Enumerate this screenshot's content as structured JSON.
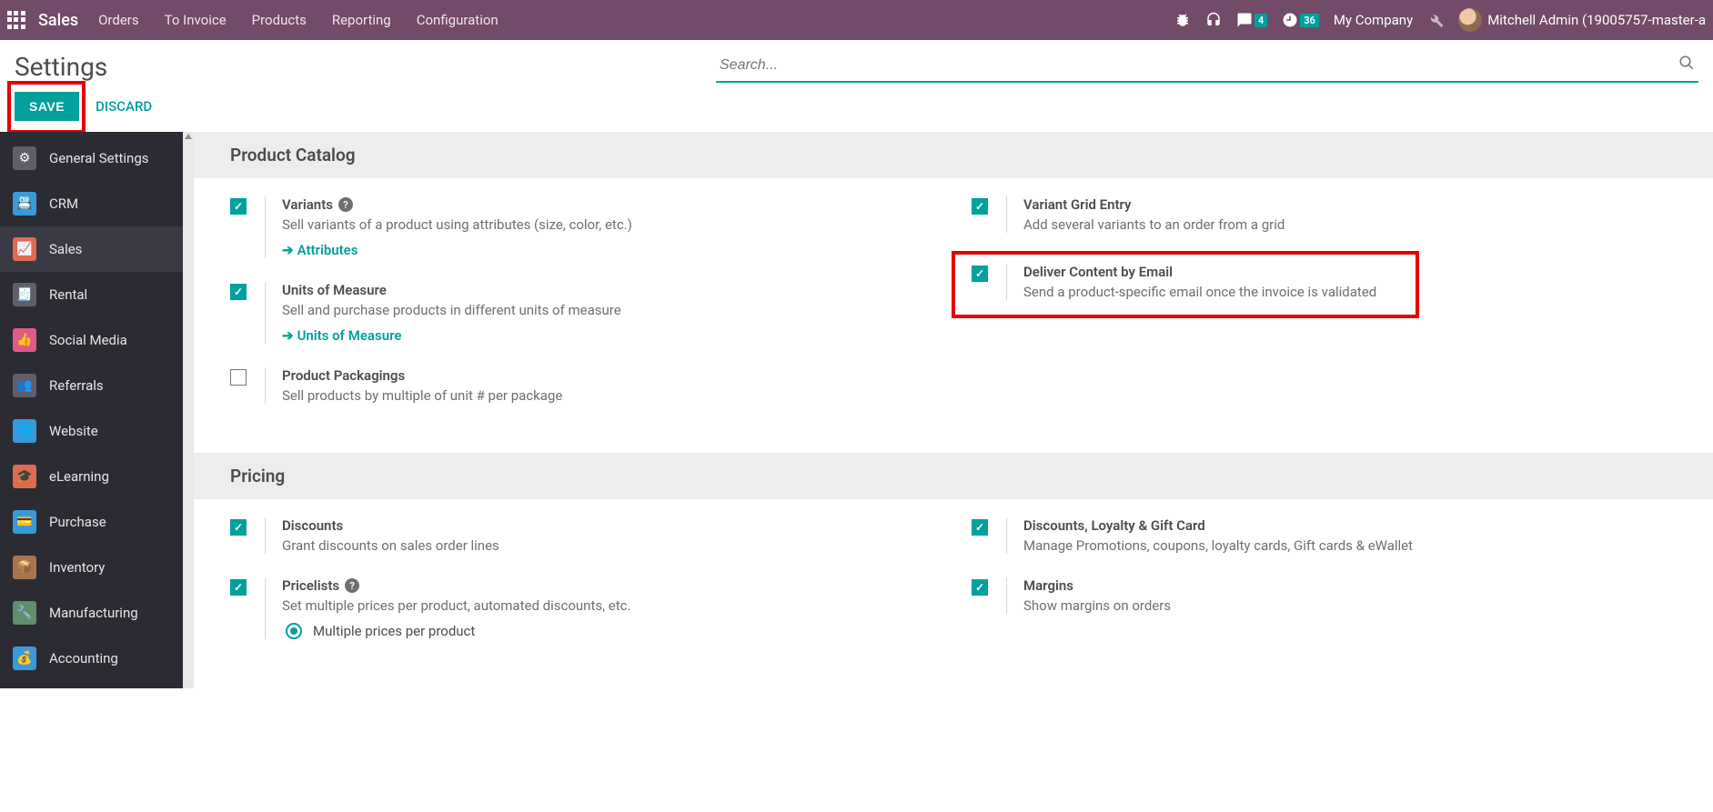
{
  "navbar": {
    "brand": "Sales",
    "links": [
      "Orders",
      "To Invoice",
      "Products",
      "Reporting",
      "Configuration"
    ],
    "msg_badge": "4",
    "activity_badge": "36",
    "company": "My Company",
    "user": "Mitchell Admin (19005757-master-a"
  },
  "page": {
    "title": "Settings",
    "search_placeholder": "Search...",
    "save": "SAVE",
    "discard": "DISCARD"
  },
  "sidebar": [
    {
      "label": "General Settings",
      "icon": "ic-gear"
    },
    {
      "label": "CRM",
      "icon": "ic-crm"
    },
    {
      "label": "Sales",
      "icon": "ic-sales",
      "active": true
    },
    {
      "label": "Rental",
      "icon": "ic-rental"
    },
    {
      "label": "Social Media",
      "icon": "ic-social"
    },
    {
      "label": "Referrals",
      "icon": "ic-referrals"
    },
    {
      "label": "Website",
      "icon": "ic-website"
    },
    {
      "label": "eLearning",
      "icon": "ic-elearning"
    },
    {
      "label": "Purchase",
      "icon": "ic-purchase"
    },
    {
      "label": "Inventory",
      "icon": "ic-inventory"
    },
    {
      "label": "Manufacturing",
      "icon": "ic-manufacturing"
    },
    {
      "label": "Accounting",
      "icon": "ic-accounting"
    }
  ],
  "sections": {
    "product_catalog": {
      "title": "Product Catalog",
      "variants": {
        "title": "Variants",
        "desc": "Sell variants of a product using attributes (size, color, etc.)",
        "link": "Attributes"
      },
      "variant_grid": {
        "title": "Variant Grid Entry",
        "desc": "Add several variants to an order from a grid"
      },
      "uom": {
        "title": "Units of Measure",
        "desc": "Sell and purchase products in different units of measure",
        "link": "Units of Measure"
      },
      "deliver_email": {
        "title": "Deliver Content by Email",
        "desc": "Send a product-specific email once the invoice is validated"
      },
      "packagings": {
        "title": "Product Packagings",
        "desc": "Sell products by multiple of unit # per package"
      }
    },
    "pricing": {
      "title": "Pricing",
      "discounts": {
        "title": "Discounts",
        "desc": "Grant discounts on sales order lines"
      },
      "loyalty": {
        "title": "Discounts, Loyalty & Gift Card",
        "desc": "Manage Promotions, coupons, loyalty cards, Gift cards & eWallet"
      },
      "pricelists": {
        "title": "Pricelists",
        "desc": "Set multiple prices per product, automated discounts, etc.",
        "radio1": "Multiple prices per product"
      },
      "margins": {
        "title": "Margins",
        "desc": "Show margins on orders"
      }
    }
  }
}
